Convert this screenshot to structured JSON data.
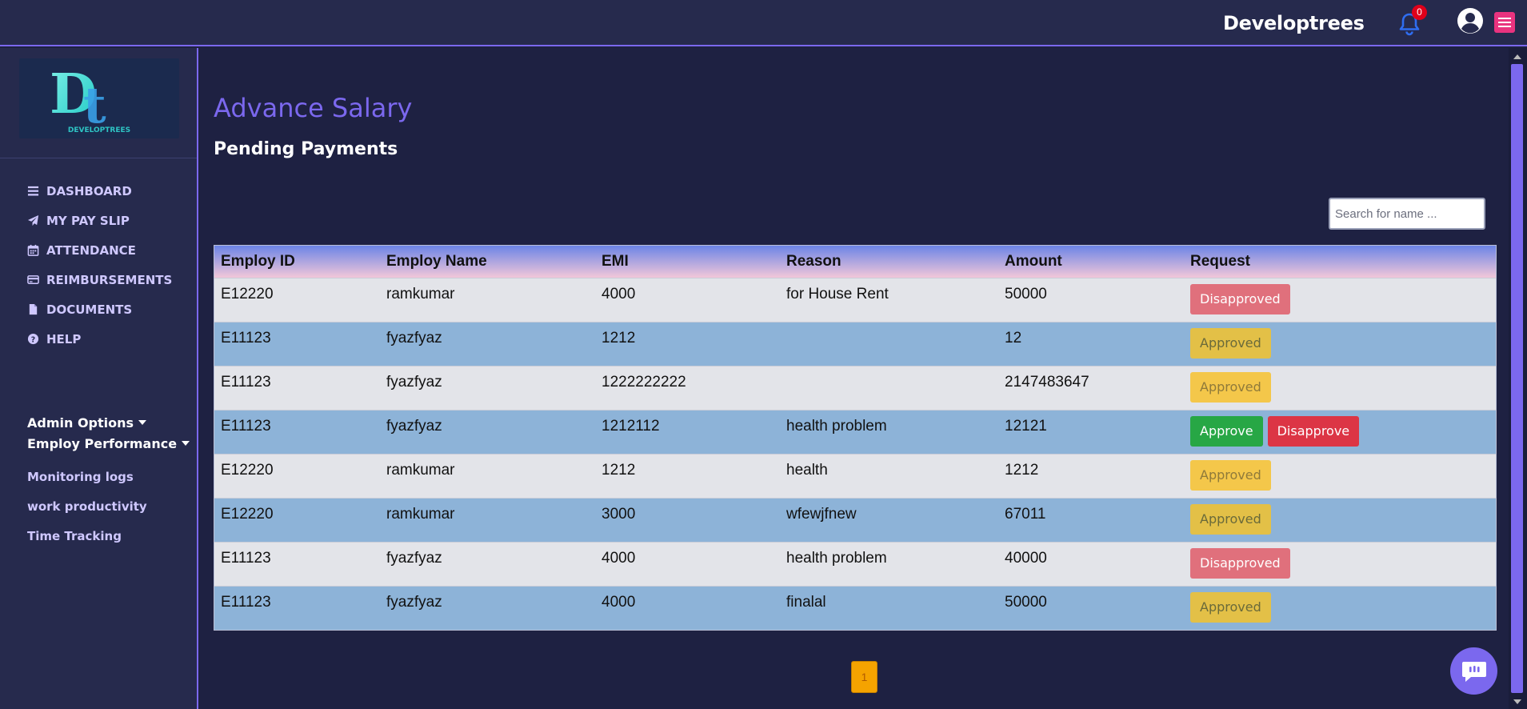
{
  "header": {
    "brand": "Developtrees",
    "notifications_count": "0"
  },
  "logo": {
    "text": "DEVELOPTREES"
  },
  "sidebar": {
    "items": [
      {
        "label": "DASHBOARD",
        "icon": "bars-icon"
      },
      {
        "label": "MY PAY SLIP",
        "icon": "paper-plane-icon"
      },
      {
        "label": "ATTENDANCE",
        "icon": "calendar-icon"
      },
      {
        "label": "REIMBURSEMENTS",
        "icon": "credit-card-icon"
      },
      {
        "label": "DOCUMENTS",
        "icon": "file-icon"
      },
      {
        "label": "HELP",
        "icon": "question-circle-icon"
      }
    ],
    "admin_options": "Admin Options",
    "employ_performance": "Employ Performance",
    "sub_links": [
      "Monitoring logs",
      "work productivity",
      "Time Tracking"
    ]
  },
  "page": {
    "title": "Advance Salary",
    "section": "Pending Payments",
    "search_placeholder": "Search for name ..."
  },
  "table": {
    "columns": [
      "Employ ID",
      "Employ Name",
      "EMI",
      "Reason",
      "Amount",
      "Request"
    ],
    "rows": [
      {
        "id": "E12220",
        "name": "ramkumar",
        "emi": "4000",
        "reason": "for House Rent",
        "amount": "50000",
        "status": "Disapproved"
      },
      {
        "id": "E11123",
        "name": "fyazfyaz",
        "emi": "1212",
        "reason": "",
        "amount": "12",
        "status": "Approved"
      },
      {
        "id": "E11123",
        "name": "fyazfyaz",
        "emi": "1222222222",
        "reason": "",
        "amount": "2147483647",
        "status": "Approved"
      },
      {
        "id": "E11123",
        "name": "fyazfyaz",
        "emi": "1212112",
        "reason": "health problem",
        "amount": "12121",
        "status": "Pending"
      },
      {
        "id": "E12220",
        "name": "ramkumar",
        "emi": "1212",
        "reason": "health",
        "amount": "1212",
        "status": "Approved"
      },
      {
        "id": "E12220",
        "name": "ramkumar",
        "emi": "3000",
        "reason": "wfewjfnew",
        "amount": "67011",
        "status": "Approved"
      },
      {
        "id": "E11123",
        "name": "fyazfyaz",
        "emi": "4000",
        "reason": "health problem",
        "amount": "40000",
        "status": "Disapproved"
      },
      {
        "id": "E11123",
        "name": "fyazfyaz",
        "emi": "4000",
        "reason": "finalal",
        "amount": "50000",
        "status": "Approved"
      }
    ],
    "labels": {
      "approve": "Approve",
      "disapprove": "Disapprove",
      "approved": "Approved",
      "disapproved": "Disapproved"
    }
  },
  "pagination": {
    "current": "1"
  }
}
